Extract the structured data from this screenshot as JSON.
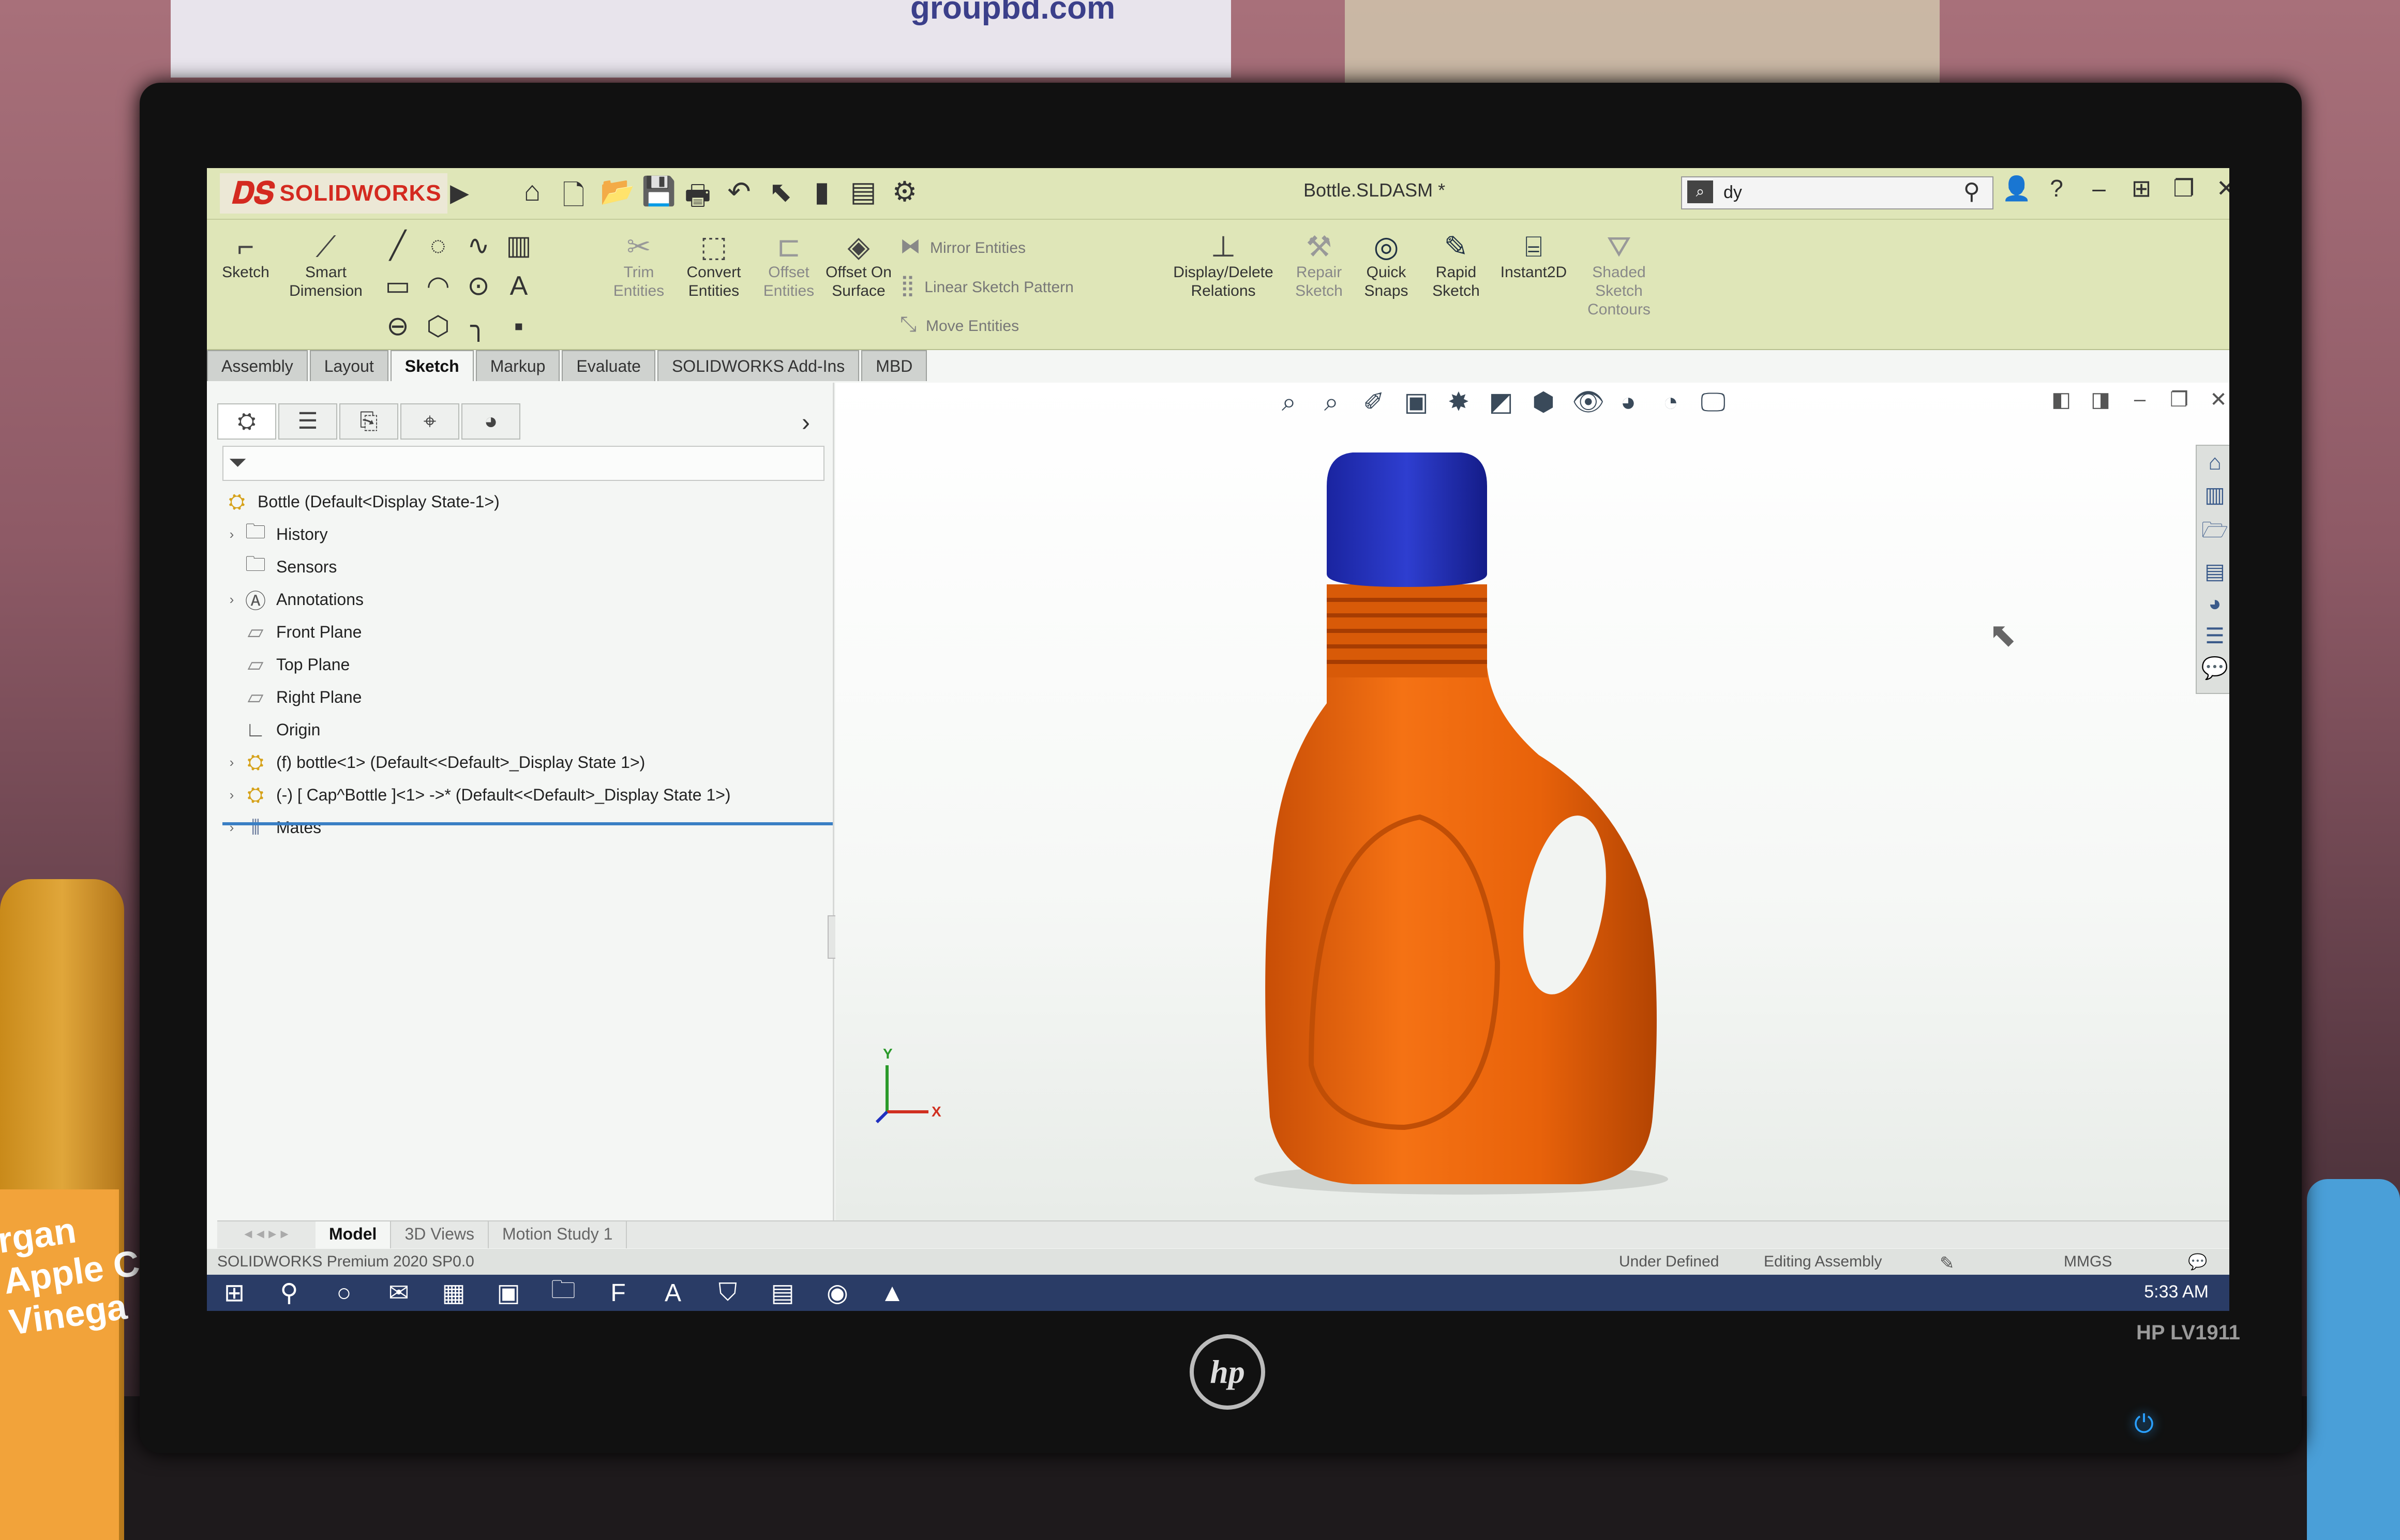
{
  "window": {
    "app_name": "SOLIDWORKS",
    "document_title": "Bottle.SLDASM *",
    "search_value": "dy"
  },
  "command_manager": {
    "sketch": "Sketch",
    "smart_dimension": "Smart Dimension",
    "trim_entities": "Trim Entities",
    "convert_entities": "Convert Entities",
    "offset_entities": "Offset Entities",
    "offset_on_surface": "Offset On Surface",
    "mirror_entities": "Mirror Entities",
    "linear_sketch_pattern": "Linear Sketch Pattern",
    "move_entities": "Move Entities",
    "display_delete_relations": "Display/Delete Relations",
    "repair_sketch": "Repair Sketch",
    "quick_snaps": "Quick Snaps",
    "rapid_sketch": "Rapid Sketch",
    "instant2d": "Instant2D",
    "shaded_sketch_contours": "Shaded Sketch Contours"
  },
  "tabs": [
    "Assembly",
    "Layout",
    "Sketch",
    "Markup",
    "Evaluate",
    "SOLIDWORKS Add-Ins",
    "MBD"
  ],
  "active_tab": "Sketch",
  "feature_tree": {
    "root": "Bottle  (Default<Display State-1>)",
    "items": [
      {
        "label": "History",
        "icon": "history-folder-icon"
      },
      {
        "label": "Sensors",
        "icon": "sensors-folder-icon"
      },
      {
        "label": "Annotations",
        "icon": "annotations-folder-icon"
      },
      {
        "label": "Front Plane",
        "icon": "plane-icon"
      },
      {
        "label": "Top Plane",
        "icon": "plane-icon"
      },
      {
        "label": "Right Plane",
        "icon": "plane-icon"
      },
      {
        "label": "Origin",
        "icon": "origin-icon"
      },
      {
        "label": "(f) bottle<1> (Default<<Default>_Display State 1>)",
        "icon": "part-icon"
      },
      {
        "label": "(-) [ Cap^Bottle ]<1> ->* (Default<<Default>_Display State 1>)",
        "icon": "part-icon"
      },
      {
        "label": "Mates",
        "icon": "mates-icon"
      }
    ]
  },
  "bottom_tabs": [
    "Model",
    "3D Views",
    "Motion Study 1"
  ],
  "status": {
    "product": "SOLIDWORKS Premium 2020 SP0.0",
    "definition": "Under Defined",
    "mode": "Editing Assembly",
    "units": "MMGS"
  },
  "triad": {
    "x": "X",
    "y": "Y"
  },
  "taskbar": {
    "clock": "5:33 AM"
  },
  "monitor": {
    "brand": "hp",
    "model": "HP LV1911"
  },
  "environment": {
    "poster_text": "groupbd.com",
    "jar_label": "rgan\nApple C\nVinega"
  },
  "colors": {
    "bottle": "#e8620a",
    "cap": "#1f2fb8",
    "ribbon_bg": "#dfe6b8",
    "brand_red": "#d42a20"
  }
}
